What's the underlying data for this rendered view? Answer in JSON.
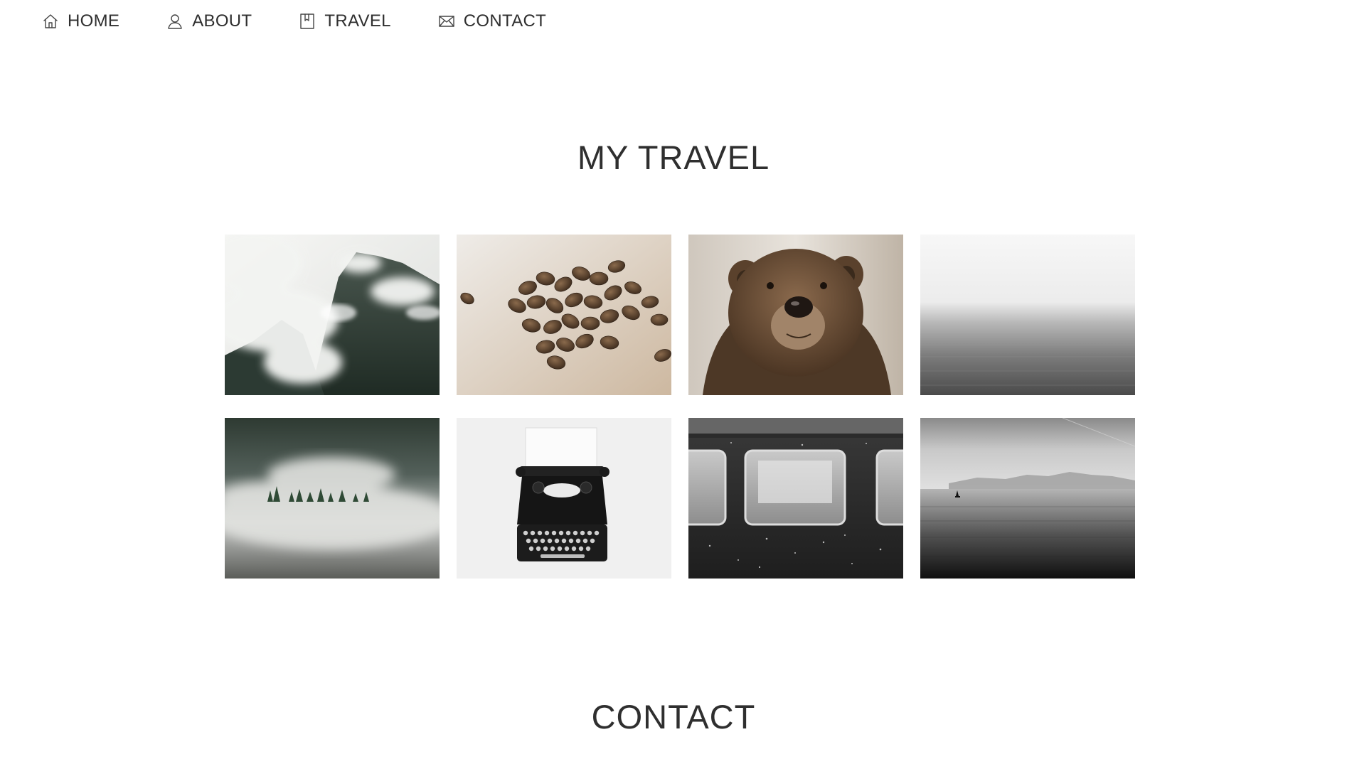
{
  "nav": {
    "items": [
      {
        "label": "HOME",
        "icon": "home-icon"
      },
      {
        "label": "ABOUT",
        "icon": "user-icon"
      },
      {
        "label": "TRAVEL",
        "icon": "bookmark-icon"
      },
      {
        "label": "CONTACT",
        "icon": "mail-icon"
      }
    ]
  },
  "travel": {
    "title": "MY TRAVEL",
    "photos": [
      {
        "subject": "misty-mountain"
      },
      {
        "subject": "coffee-beans"
      },
      {
        "subject": "brown-bear"
      },
      {
        "subject": "foggy-sea"
      },
      {
        "subject": "fog-forest"
      },
      {
        "subject": "typewriter"
      },
      {
        "subject": "train-windows"
      },
      {
        "subject": "sea-boat"
      }
    ]
  },
  "contact": {
    "title": "CONTACT"
  },
  "colors": {
    "text": "#2f2f2f",
    "background": "#ffffff"
  }
}
